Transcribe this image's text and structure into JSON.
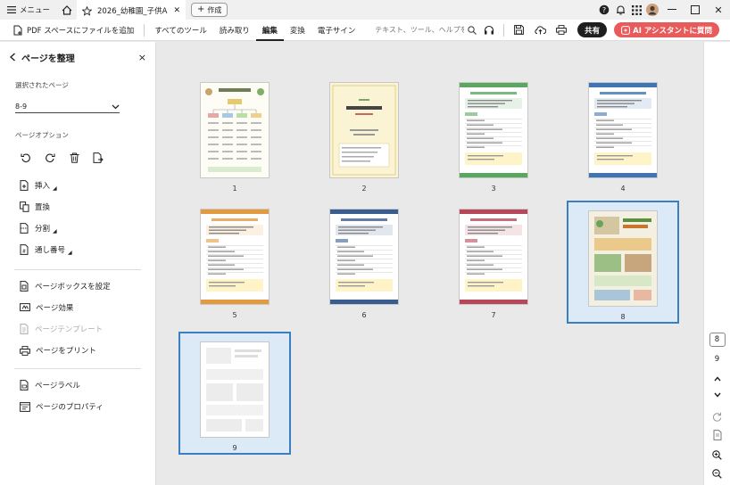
{
  "titlebar": {
    "menu_label": "メニュー",
    "tab_title": "2026_幼稚園_子供A...",
    "new_tab_label": "作成"
  },
  "toolbar": {
    "add_to_space": "PDF スペースにファイルを追加",
    "items": [
      "すべてのツール",
      "読み取り",
      "編集",
      "変換",
      "電子サイン"
    ],
    "active_index": 2,
    "search_placeholder": "テキスト、ツール、ヘルプを検索",
    "share_label": "共有",
    "ai_label": "AI アシスタントに質問"
  },
  "left_panel": {
    "title": "ページを整理",
    "selected_pages_label": "選択されたページ",
    "selected_pages_value": "8-9",
    "page_options_label": "ページオプション",
    "group1": [
      "挿入",
      "置換",
      "分割",
      "通し番号"
    ],
    "group2": [
      "ページボックスを設定",
      "ページ効果",
      "ページテンプレート",
      "ページをプリント"
    ],
    "group3": [
      "ページラベル",
      "ページのプロパティ"
    ]
  },
  "pages": [
    {
      "num": "1",
      "style": "flow",
      "selected": false
    },
    {
      "num": "2",
      "style": "cover",
      "selected": false
    },
    {
      "num": "3",
      "style": "green",
      "selected": false
    },
    {
      "num": "4",
      "style": "blue",
      "selected": false
    },
    {
      "num": "5",
      "style": "orange",
      "selected": false
    },
    {
      "num": "6",
      "style": "navy",
      "selected": false
    },
    {
      "num": "7",
      "style": "red",
      "selected": false
    },
    {
      "num": "8",
      "style": "poster",
      "selected": true
    },
    {
      "num": "9",
      "style": "faded",
      "selected": true
    }
  ],
  "right_bar": {
    "current_page": "8",
    "total_pages": "9"
  },
  "colors": {
    "accent": "#3a7fc1",
    "ai_button": "#e95b5b",
    "share_button": "#1f1f1f"
  }
}
